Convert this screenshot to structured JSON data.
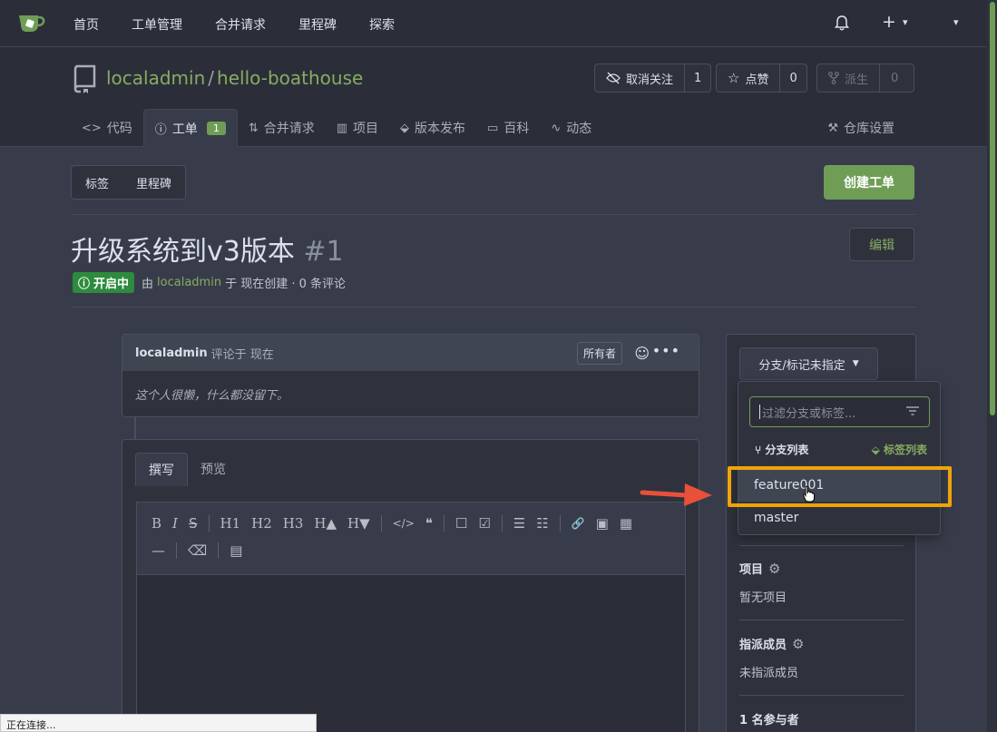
{
  "nav": {
    "items": [
      "首页",
      "工单管理",
      "合并请求",
      "里程碑",
      "探索"
    ],
    "plus": "+",
    "caret": "▾"
  },
  "repo": {
    "owner": "localadmin",
    "separator": "/",
    "name": "hello-boathouse",
    "unwatch_label": "取消关注",
    "unwatch_count": "1",
    "star_label": "点赞",
    "star_count": "0",
    "fork_label": "派生",
    "fork_count": "0"
  },
  "tabs": [
    {
      "label": "代码",
      "icon": "code-icon"
    },
    {
      "label": "工单",
      "icon": "issue-icon",
      "badge": "1"
    },
    {
      "label": "合并请求",
      "icon": "pull-request-icon"
    },
    {
      "label": "项目",
      "icon": "project-icon"
    },
    {
      "label": "版本发布",
      "icon": "tag-icon"
    },
    {
      "label": "百科",
      "icon": "book-icon"
    },
    {
      "label": "动态",
      "icon": "pulse-icon"
    }
  ],
  "settings_tab": "仓库设置",
  "filter_buttons": {
    "labels": "标签",
    "milestones": "里程碑"
  },
  "new_issue": "创建工单",
  "issue": {
    "title": "升级系统到v3版本",
    "number": "#1",
    "edit": "编辑",
    "status": "开启中",
    "by": "由",
    "author": "localadmin",
    "meta": "于 现在创建 · 0 条评论"
  },
  "comment": {
    "author": "localadmin",
    "meta": "评论于 现在",
    "owner_tag": "所有者",
    "body": "这个人很懒，什么都没留下。"
  },
  "editor": {
    "tab_write": "撰写",
    "tab_preview": "预览",
    "toolbar_row1": [
      "B",
      "I",
      "S",
      "H1",
      "H2",
      "H3",
      "H▲",
      "H▼",
      "</>",
      "❝",
      "☐",
      "☑",
      "☰",
      "☷",
      "🔗",
      "▣",
      "▦"
    ],
    "toolbar_row2": [
      "—",
      "⌫",
      "▤"
    ]
  },
  "sidebar": {
    "branch_button": "分支/标记未指定",
    "filter_placeholder": "过滤分支或标签...",
    "tab_branches": "分支列表",
    "tab_tags": "标签列表",
    "branches": [
      "feature001",
      "master"
    ],
    "project_label": "项目",
    "project_value": "暂无项目",
    "assignee_label": "指派成员",
    "assignee_value": "未指派成员",
    "participants": "1 名参与者"
  },
  "statusbar": "正在连接...",
  "colors": {
    "accent": "#87ab63",
    "primary_button": "#6f9d56",
    "highlight": "#f0a30a",
    "arrow": "#e8503a"
  }
}
